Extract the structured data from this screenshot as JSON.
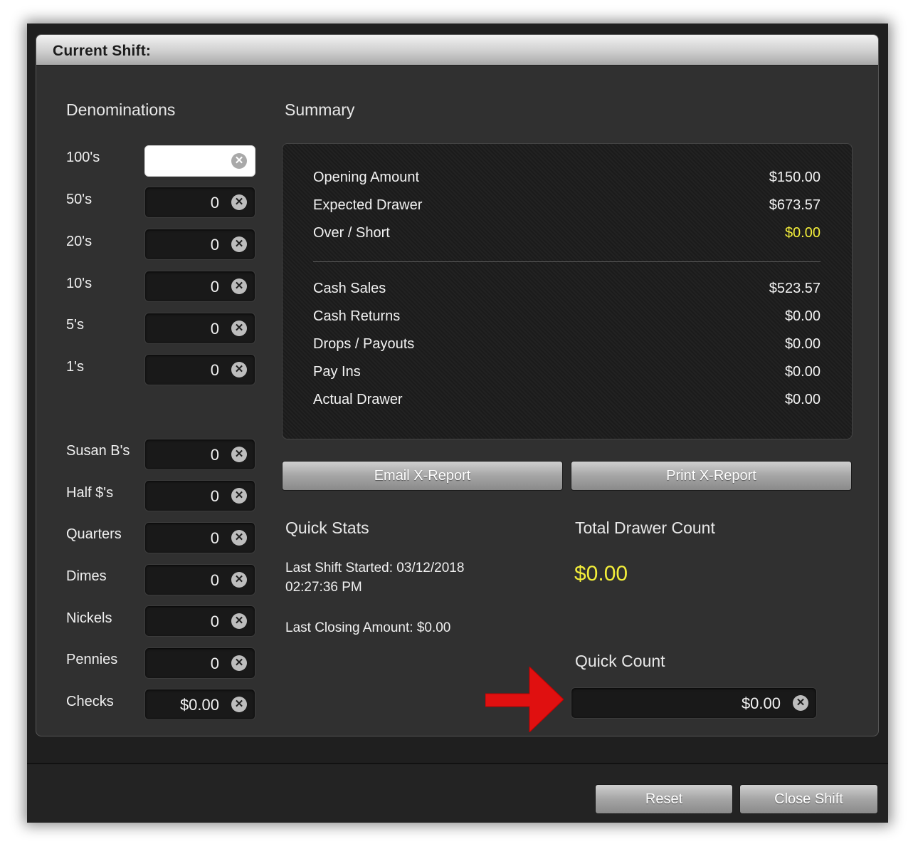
{
  "panel": {
    "title": "Current Shift:"
  },
  "denominations": {
    "heading": "Denominations",
    "bills": [
      {
        "label": "100's",
        "value": ""
      },
      {
        "label": "50's",
        "value": "0"
      },
      {
        "label": "20's",
        "value": "0"
      },
      {
        "label": "10's",
        "value": "0"
      },
      {
        "label": "5's",
        "value": "0"
      },
      {
        "label": "1's",
        "value": "0"
      }
    ],
    "coins": [
      {
        "label": "Susan B's",
        "value": "0"
      },
      {
        "label": "Half $'s",
        "value": "0"
      },
      {
        "label": "Quarters",
        "value": "0"
      },
      {
        "label": "Dimes",
        "value": "0"
      },
      {
        "label": "Nickels",
        "value": "0"
      },
      {
        "label": "Pennies",
        "value": "0"
      },
      {
        "label": "Checks",
        "value": "$0.00"
      }
    ]
  },
  "summary": {
    "heading": "Summary",
    "top_rows": [
      {
        "label": "Opening Amount",
        "value": "$150.00"
      },
      {
        "label": "Expected Drawer",
        "value": "$673.57"
      },
      {
        "label": "Over / Short",
        "value": "$0.00"
      }
    ],
    "bottom_rows": [
      {
        "label": "Cash Sales",
        "value": "$523.57"
      },
      {
        "label": "Cash Returns",
        "value": "$0.00"
      },
      {
        "label": "Drops / Payouts",
        "value": "$0.00"
      },
      {
        "label": "Pay Ins",
        "value": "$0.00"
      },
      {
        "label": "Actual Drawer",
        "value": "$0.00"
      }
    ]
  },
  "buttons": {
    "email_report": "Email X-Report",
    "print_report": "Print X-Report",
    "reset": "Reset",
    "close_shift": "Close Shift"
  },
  "quick_stats": {
    "heading": "Quick Stats",
    "last_shift_line1": "Last Shift Started: 03/12/2018",
    "last_shift_line2": "02:27:36 PM",
    "last_closing": "Last Closing Amount: $0.00"
  },
  "total_drawer": {
    "heading": "Total Drawer Count",
    "value": "$0.00"
  },
  "quick_count": {
    "heading": "Quick Count",
    "value": "$0.00"
  },
  "colors": {
    "highlight_yellow": "#f3ee3a",
    "annotation_arrow": "#e01010"
  }
}
